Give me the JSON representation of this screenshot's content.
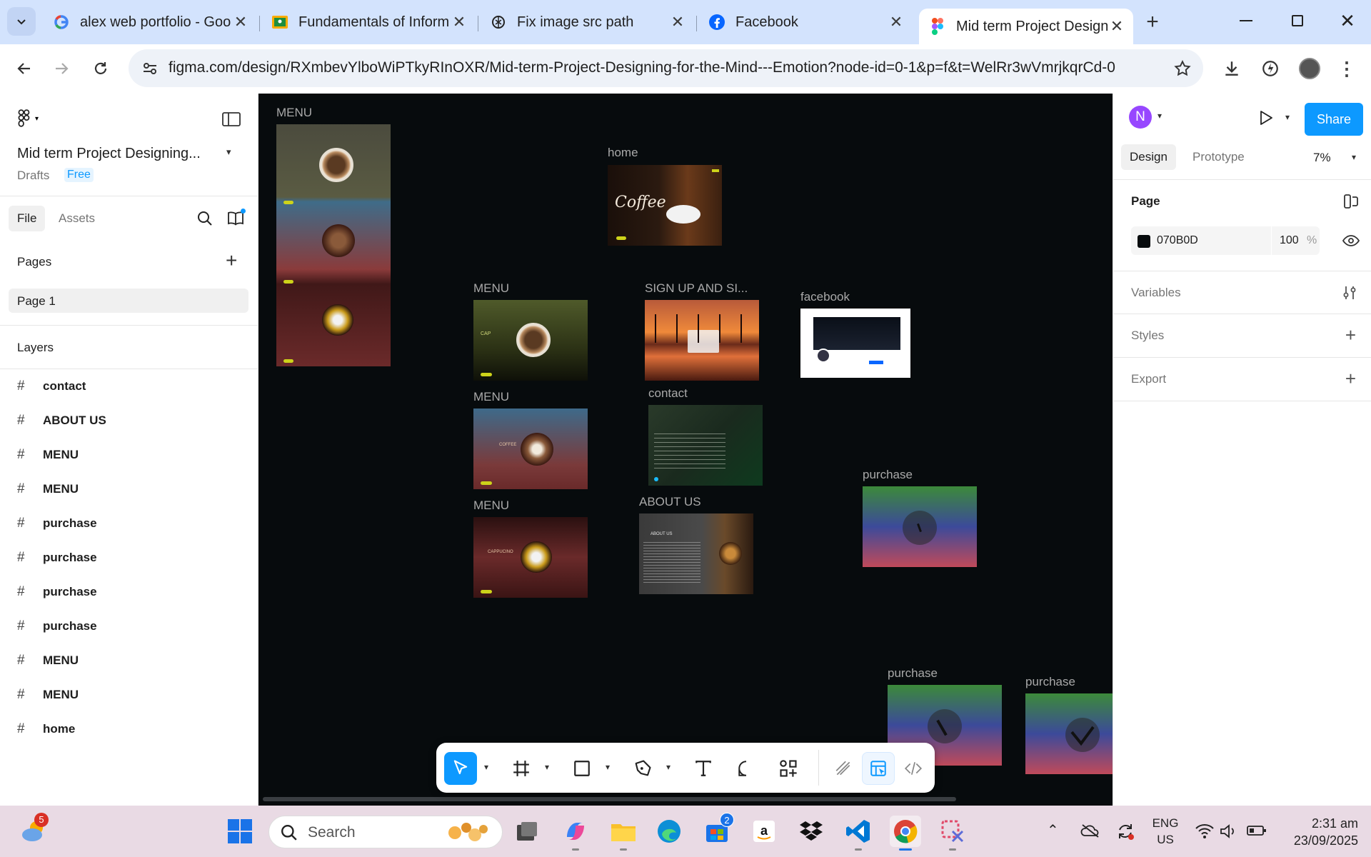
{
  "browser": {
    "tabs": [
      {
        "title": "alex web portfolio - Goog",
        "icon": "google-icon"
      },
      {
        "title": "Fundamentals of Informa",
        "icon": "classroom-icon"
      },
      {
        "title": "Fix image src path",
        "icon": "chatgpt-icon"
      },
      {
        "title": "Facebook",
        "icon": "facebook-icon"
      },
      {
        "title": "Mid term Project Designi",
        "icon": "figma-icon"
      }
    ],
    "url": "figma.com/design/RXmbevYlboWiPTkyRInOXR/Mid-term-Project-Designing-for-the-Mind---Emotion?node-id=0-1&p=f&t=WelRr3wVmrjkqrCd-0"
  },
  "figma": {
    "file_title": "Mid term Project Designing...",
    "drafts_label": "Drafts",
    "plan_badge": "Free",
    "tabs": {
      "file": "File",
      "assets": "Assets"
    },
    "pages_header": "Pages",
    "pages": [
      "Page 1"
    ],
    "layers_header": "Layers",
    "layers": [
      "contact",
      "ABOUT US",
      "MENU",
      "MENU",
      "purchase",
      "purchase",
      "purchase",
      "purchase",
      "MENU",
      "MENU",
      "home"
    ],
    "canvas_labels": {
      "menu_top": "MENU",
      "home": "home",
      "menu_1": "MENU",
      "signup": "SIGN UP AND SI...",
      "facebook": "facebook",
      "menu_2": "MENU",
      "contact": "contact",
      "purchase_1": "purchase",
      "menu_3": "MENU",
      "about": "ABOUT US",
      "purchase_2": "purchase",
      "purchase_3": "purchase"
    },
    "frame_texts": {
      "coffee": "Coffee",
      "cap": "CAP",
      "coffee_word": "COFFEE",
      "cappuccino": "CAPPUCINO",
      "about_us": "ABOUT US"
    },
    "right": {
      "avatar_letter": "N",
      "share": "Share",
      "design_tab": "Design",
      "prototype_tab": "Prototype",
      "zoom": "7%",
      "page_header": "Page",
      "page_color_hex": "070B0D",
      "opacity": "100",
      "opacity_unit": "%",
      "variables": "Variables",
      "styles": "Styles",
      "export": "Export"
    },
    "help": "?",
    "colors": {
      "canvas": "#070b0d",
      "accent": "#0d99ff"
    }
  },
  "taskbar": {
    "weather_badge": "5",
    "search_placeholder": "Search",
    "store_badge": "2",
    "lang_1": "ENG",
    "lang_2": "US",
    "time": "2:31 am",
    "date": "23/09/2025"
  }
}
